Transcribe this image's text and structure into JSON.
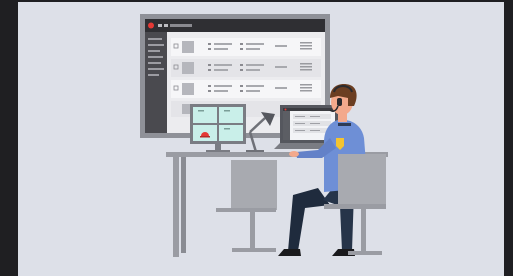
{
  "scene": {
    "background_color": "#dde0e8",
    "frame_color": "#1f1f22",
    "wall_screen": {
      "theme": "dark-admin-dashboard",
      "header_color": "#2f2f33",
      "sidebar_color": "#4a4a4f",
      "content_color": "#ececef",
      "accent_color": "#e53935",
      "row_count": 4
    },
    "desk_monitor": {
      "camera_grid": "2x2",
      "tile_color": "#c9efe9",
      "alarm_color": "#e53935"
    },
    "laptop": {
      "screen_color": "#f2f3f6"
    },
    "operator": {
      "shirt_color": "#6e8fd6",
      "trousers_color": "#1f2b3d",
      "hair_color": "#6b3e22",
      "skin_color": "#f3a98c",
      "badge_color": "#f4c430",
      "headset": true
    },
    "furniture_color": "#9a9ca3"
  }
}
